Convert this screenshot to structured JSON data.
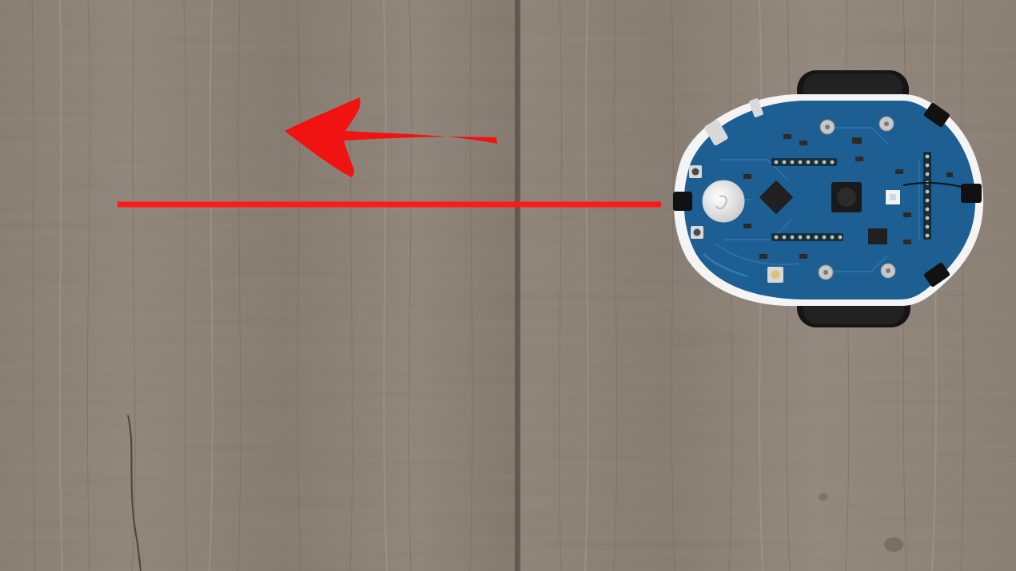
{
  "scene": {
    "description_tag": "photo",
    "floor": {
      "material": "wood-planks",
      "base_color": "#8c8176",
      "light_color": "#a49a8f",
      "dark_color": "#6f655b",
      "seam_color": "#5a5048"
    },
    "annotations": {
      "path_line_color": "#ff1a1a",
      "direction_arrow_color": "#f11212",
      "direction": "left"
    },
    "robot": {
      "board_color": "#1d5f93",
      "board_edge_color": "#f4f4f4",
      "wheel_color": "#141414",
      "chip_color": "#202020",
      "sensor_dome_color": "#ececec"
    }
  }
}
